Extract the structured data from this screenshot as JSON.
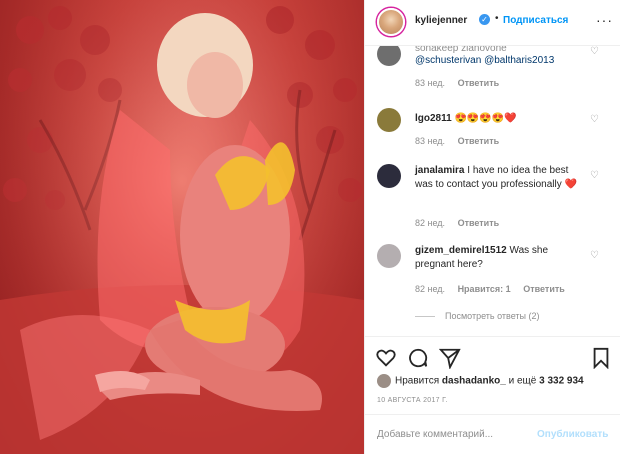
{
  "header": {
    "username": "kyliejenner",
    "verified_mark": "✓",
    "separator": "•",
    "follow_label": "Подписаться",
    "more_label": "···"
  },
  "comments": [
    {
      "user": "",
      "text_prefix": "",
      "mentions": "@schusterivan @baltharis2013",
      "time": "83 нед.",
      "reply": "Ответить",
      "partial_top": "sonakeep zlanovone"
    },
    {
      "user": "lgo2811",
      "text": "😍😍😍😍❤️",
      "time": "83 нед.",
      "reply": "Ответить"
    },
    {
      "user": "janalamira",
      "text": "I have no idea the best was to contact you professionally ❤️",
      "time": "82 нед.",
      "reply": "Ответить"
    },
    {
      "user": "gizem_demirel1512",
      "text": "Was she pregnant here?",
      "time": "82 нед.",
      "likes": "Нравится: 1",
      "reply": "Ответить"
    }
  ],
  "view_replies": "Посмотреть ответы (2)",
  "icons": [
    "heart-icon",
    "comment-icon",
    "share-icon",
    "bookmark-icon"
  ],
  "likes": {
    "prefix": "Нравится",
    "user": "dashadanko_",
    "middle": "и ещё",
    "count": "3 332 934"
  },
  "date": "10 АВГУСТА 2017 Г.",
  "add_comment": {
    "placeholder": "Добавьте комментарий...",
    "publish_label": "Опубликовать"
  },
  "colors": {
    "accent": "#0095f6",
    "publish_disabled": "#b2dffc",
    "photo_red": "#c8403a"
  }
}
